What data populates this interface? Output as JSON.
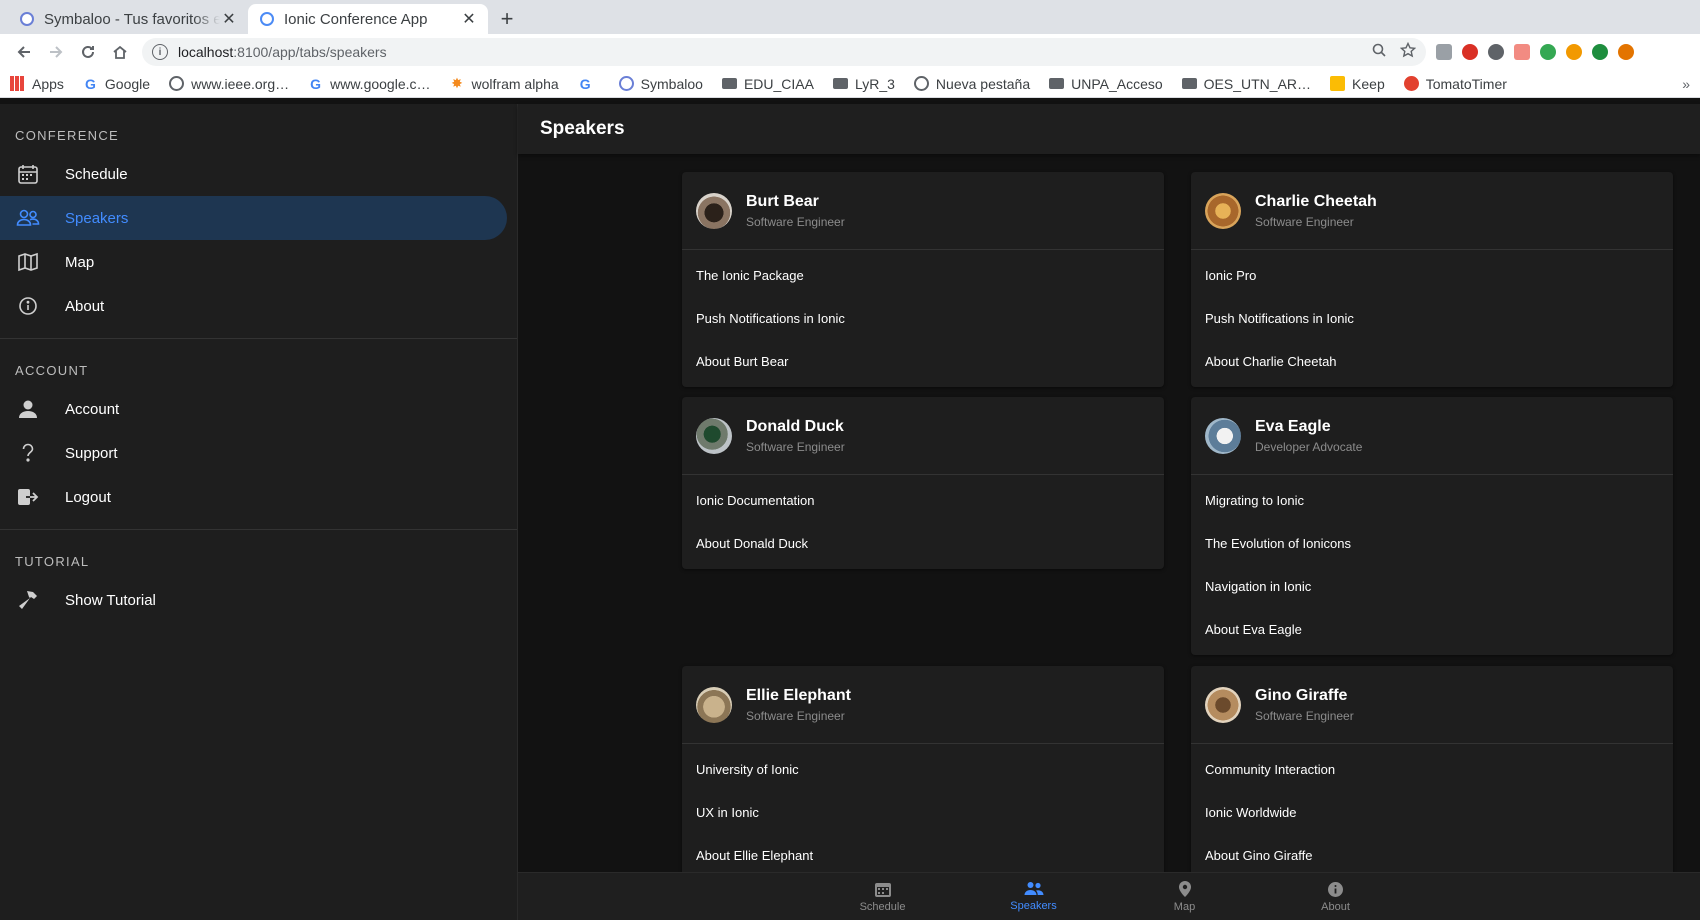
{
  "browser": {
    "tabs": [
      {
        "title": "Symbaloo - Tus favoritos e",
        "active": false
      },
      {
        "title": "Ionic Conference App",
        "active": true
      }
    ],
    "new_tab": "+",
    "url_host": "localhost",
    "url_path": ":8100/app/tabs/speakers",
    "bookmarks": [
      {
        "label": "Apps",
        "icon": "apps-grid-icon"
      },
      {
        "label": "Google",
        "icon": "google-icon"
      },
      {
        "label": "www.ieee.org…",
        "icon": "globe-icon"
      },
      {
        "label": "www.google.c…",
        "icon": "google-icon"
      },
      {
        "label": "wolfram alpha",
        "icon": "wolfram-icon"
      },
      {
        "label": "",
        "icon": "google-icon"
      },
      {
        "label": "Symbaloo",
        "icon": "symbaloo-icon"
      },
      {
        "label": "EDU_CIAA",
        "icon": "folder-icon"
      },
      {
        "label": "LyR_3",
        "icon": "folder-icon"
      },
      {
        "label": "Nueva pestaña",
        "icon": "globe-icon"
      },
      {
        "label": "UNPA_Acceso",
        "icon": "folder-icon"
      },
      {
        "label": "OES_UTN_AR…",
        "icon": "folder-icon"
      },
      {
        "label": "Keep",
        "icon": "keep-icon"
      },
      {
        "label": "TomatoTimer",
        "icon": "tomato-icon"
      }
    ],
    "bookmarks_more": "»"
  },
  "menu": {
    "sections": [
      {
        "heading": "CONFERENCE",
        "items": [
          {
            "label": "Schedule",
            "icon": "calendar-icon",
            "selected": false
          },
          {
            "label": "Speakers",
            "icon": "people-icon",
            "selected": true
          },
          {
            "label": "Map",
            "icon": "map-icon",
            "selected": false
          },
          {
            "label": "About",
            "icon": "info-icon",
            "selected": false
          }
        ]
      },
      {
        "heading": "ACCOUNT",
        "items": [
          {
            "label": "Account",
            "icon": "person-icon"
          },
          {
            "label": "Support",
            "icon": "help-icon"
          },
          {
            "label": "Logout",
            "icon": "logout-icon"
          }
        ]
      },
      {
        "heading": "TUTORIAL",
        "items": [
          {
            "label": "Show Tutorial",
            "icon": "hammer-icon"
          }
        ]
      }
    ]
  },
  "page": {
    "title": "Speakers"
  },
  "speakers": [
    {
      "name": "Burt Bear",
      "role": "Software Engineer",
      "talks": [
        "The Ionic Package",
        "Push Notifications in Ionic",
        "About Burt Bear"
      ],
      "avatar_color": "#5b4a3a"
    },
    {
      "name": "Charlie Cheetah",
      "role": "Software Engineer",
      "talks": [
        "Ionic Pro",
        "Push Notifications in Ionic",
        "About Charlie Cheetah"
      ],
      "avatar_color": "#c98a3c"
    },
    {
      "name": "Donald Duck",
      "role": "Software Engineer",
      "talks": [
        "Ionic Documentation",
        "About Donald Duck"
      ],
      "avatar_color": "#2f5a3a"
    },
    {
      "name": "Eva Eagle",
      "role": "Developer Advocate",
      "talks": [
        "Migrating to Ionic",
        "The Evolution of Ionicons",
        "Navigation in Ionic",
        "About Eva Eagle"
      ],
      "avatar_color": "#4a6e8c"
    },
    {
      "name": "Ellie Elephant",
      "role": "Software Engineer",
      "talks": [
        "University of Ionic",
        "UX in Ionic",
        "About Ellie Elephant"
      ],
      "avatar_color": "#a08c6a"
    },
    {
      "name": "Gino Giraffe",
      "role": "Software Engineer",
      "talks": [
        "Community Interaction",
        "Ionic Worldwide",
        "About Gino Giraffe"
      ],
      "avatar_color": "#8c6a4a"
    }
  ],
  "tabbar": [
    {
      "label": "Schedule",
      "icon": "calendar-icon",
      "selected": false
    },
    {
      "label": "Speakers",
      "icon": "people-icon",
      "selected": true
    },
    {
      "label": "Map",
      "icon": "location-icon",
      "selected": false
    },
    {
      "label": "About",
      "icon": "info-icon",
      "selected": false
    }
  ],
  "colors": {
    "accent": "#428cff",
    "selected_bg": "#1e3651",
    "menu_bg": "#1e1e1e",
    "card_bg": "#1e1e1e",
    "page_bg": "#121212"
  }
}
